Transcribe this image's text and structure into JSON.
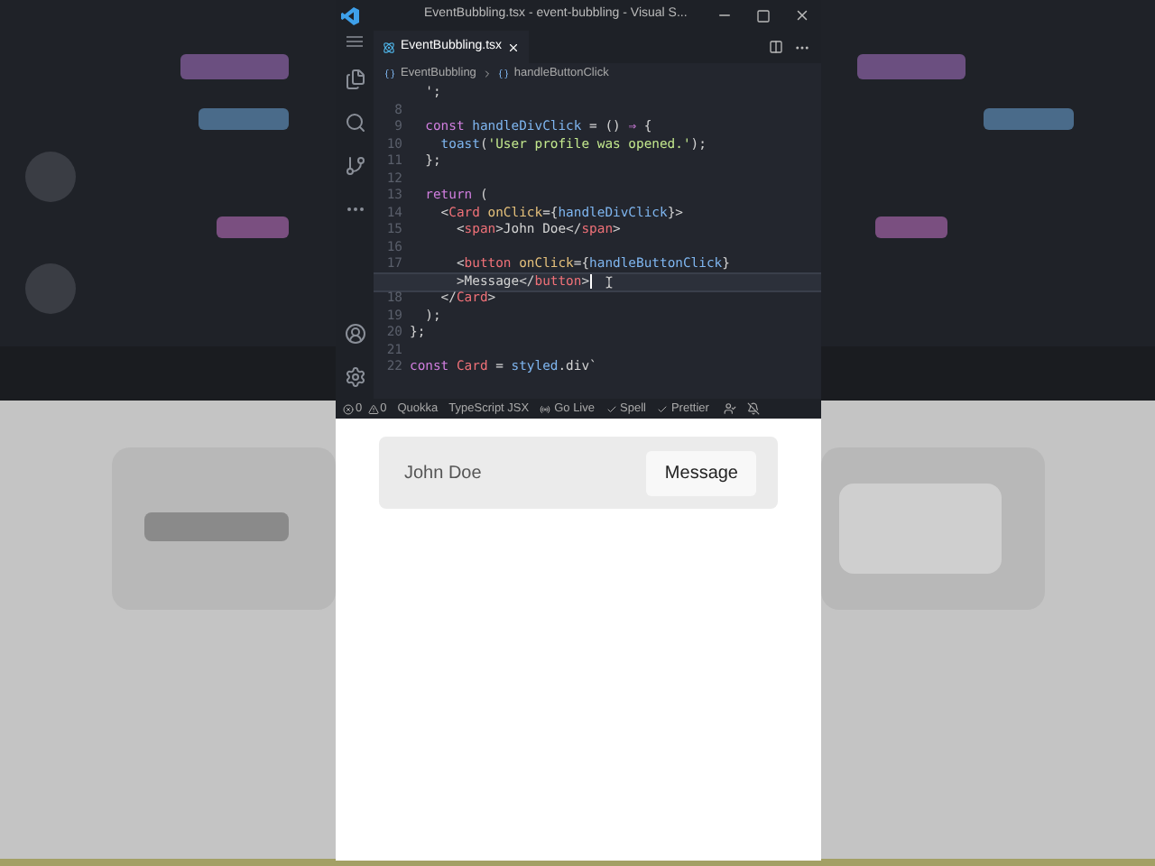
{
  "window": {
    "title": "EventBubbling.tsx - event-bubbling - Visual S..."
  },
  "tabs": [
    {
      "label": "EventBubbling.tsx",
      "selected": true
    }
  ],
  "breadcrumb": [
    "EventBubbling",
    "handleButtonClick"
  ],
  "code_lines": [
    {
      "tokens": [
        {
          "kind": "plain",
          "text": "  ';"
        }
      ],
      "current": false
    },
    {
      "number": "8",
      "current": false
    },
    {
      "number": "9",
      "tokens": [
        {
          "kind": "keyword",
          "text": "  const"
        },
        {
          "kind": "function",
          "text": " handleDivClick"
        },
        {
          "kind": "plain",
          "text": " = () "
        },
        {
          "kind": "keyword",
          "text": "⇒"
        },
        {
          "kind": "plain",
          "text": " {"
        }
      ],
      "current": false
    },
    {
      "number": "10",
      "tokens": [
        {
          "kind": "function",
          "text": "    toast"
        },
        {
          "kind": "plain",
          "text": "("
        },
        {
          "kind": "string",
          "text": "'User profile was opened.'"
        },
        {
          "kind": "plain",
          "text": ");"
        }
      ],
      "current": false
    },
    {
      "number": "11",
      "tokens": [
        {
          "kind": "plain",
          "text": "  };"
        }
      ],
      "current": false
    },
    {
      "number": "12",
      "current": false
    },
    {
      "number": "13",
      "tokens": [
        {
          "kind": "keyword",
          "text": "  return"
        },
        {
          "kind": "plain",
          "text": " ("
        }
      ],
      "current": false
    },
    {
      "number": "14",
      "tokens": [
        {
          "kind": "plain",
          "text": "    <"
        },
        {
          "kind": "tag",
          "text": "Card"
        },
        {
          "kind": "attribute",
          "text": " onClick"
        },
        {
          "kind": "plain",
          "text": "={"
        },
        {
          "kind": "function",
          "text": "handleDivClick"
        },
        {
          "kind": "plain",
          "text": "}>"
        }
      ],
      "current": false
    },
    {
      "number": "15",
      "tokens": [
        {
          "kind": "plain",
          "text": "      <"
        },
        {
          "kind": "tag",
          "text": "span"
        },
        {
          "kind": "plain",
          "text": ">John Doe</"
        },
        {
          "kind": "tag",
          "text": "span"
        },
        {
          "kind": "plain",
          "text": ">"
        }
      ],
      "current": false
    },
    {
      "number": "16",
      "current": false
    },
    {
      "number": "17",
      "tokens": [
        {
          "kind": "plain",
          "text": "      <"
        },
        {
          "kind": "tag",
          "text": "button"
        },
        {
          "kind": "attribute",
          "text": " onClick"
        },
        {
          "kind": "plain",
          "text": "={"
        },
        {
          "kind": "function",
          "text": "handleButtonClick"
        },
        {
          "kind": "plain",
          "text": "}"
        }
      ],
      "current": false
    },
    {
      "tokens": [
        {
          "kind": "plain",
          "text": "      >Message</"
        },
        {
          "kind": "tag",
          "text": "button"
        },
        {
          "kind": "plain",
          "text": ">"
        }
      ],
      "current": true
    },
    {
      "number": "18",
      "tokens": [
        {
          "kind": "plain",
          "text": "    </"
        },
        {
          "kind": "tag",
          "text": "Card"
        },
        {
          "kind": "plain",
          "text": ">"
        }
      ],
      "current": false
    },
    {
      "number": "19",
      "tokens": [
        {
          "kind": "plain",
          "text": "  );"
        }
      ],
      "current": false
    },
    {
      "number": "20",
      "tokens": [
        {
          "kind": "plain",
          "text": "};"
        }
      ],
      "current": false
    },
    {
      "number": "21",
      "current": false
    },
    {
      "number": "22",
      "tokens": [
        {
          "kind": "keyword",
          "text": "const"
        },
        {
          "kind": "tag",
          "text": " Card"
        },
        {
          "kind": "plain",
          "text": " = "
        },
        {
          "kind": "function",
          "text": "styled"
        },
        {
          "kind": "plain",
          "text": ".div`"
        }
      ],
      "current": false
    }
  ],
  "status_bar": {
    "errors": "0",
    "warnings": "0",
    "items": [
      "Quokka",
      "TypeScript JSX",
      "Go Live",
      "Spell",
      "Prettier"
    ]
  },
  "preview": {
    "name": "John Doe",
    "button": "Message"
  }
}
